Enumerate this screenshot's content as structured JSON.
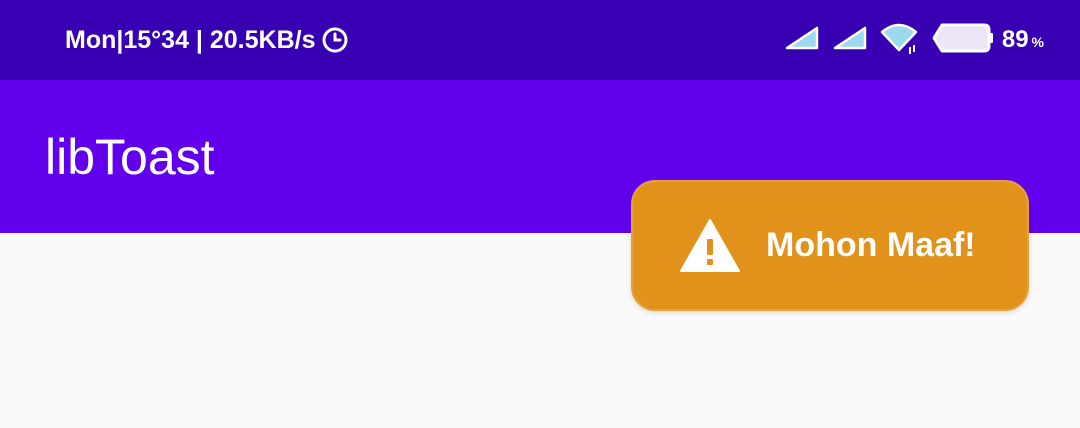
{
  "status_bar": {
    "time_text": "Mon|15°34 | 20.5KB/s",
    "battery_percent": "89",
    "percent_sign": "%",
    "icons": [
      "clock-icon",
      "signal-icon",
      "signal-icon",
      "wifi-icon",
      "battery-icon"
    ]
  },
  "app_bar": {
    "title": "libToast"
  },
  "toast": {
    "message": "Mohon Maaf!",
    "icon": "warning-icon"
  },
  "colors": {
    "status_bar": "#3700b3",
    "app_bar": "#6200ee",
    "toast": "#e0921b",
    "background": "#fafafa"
  }
}
